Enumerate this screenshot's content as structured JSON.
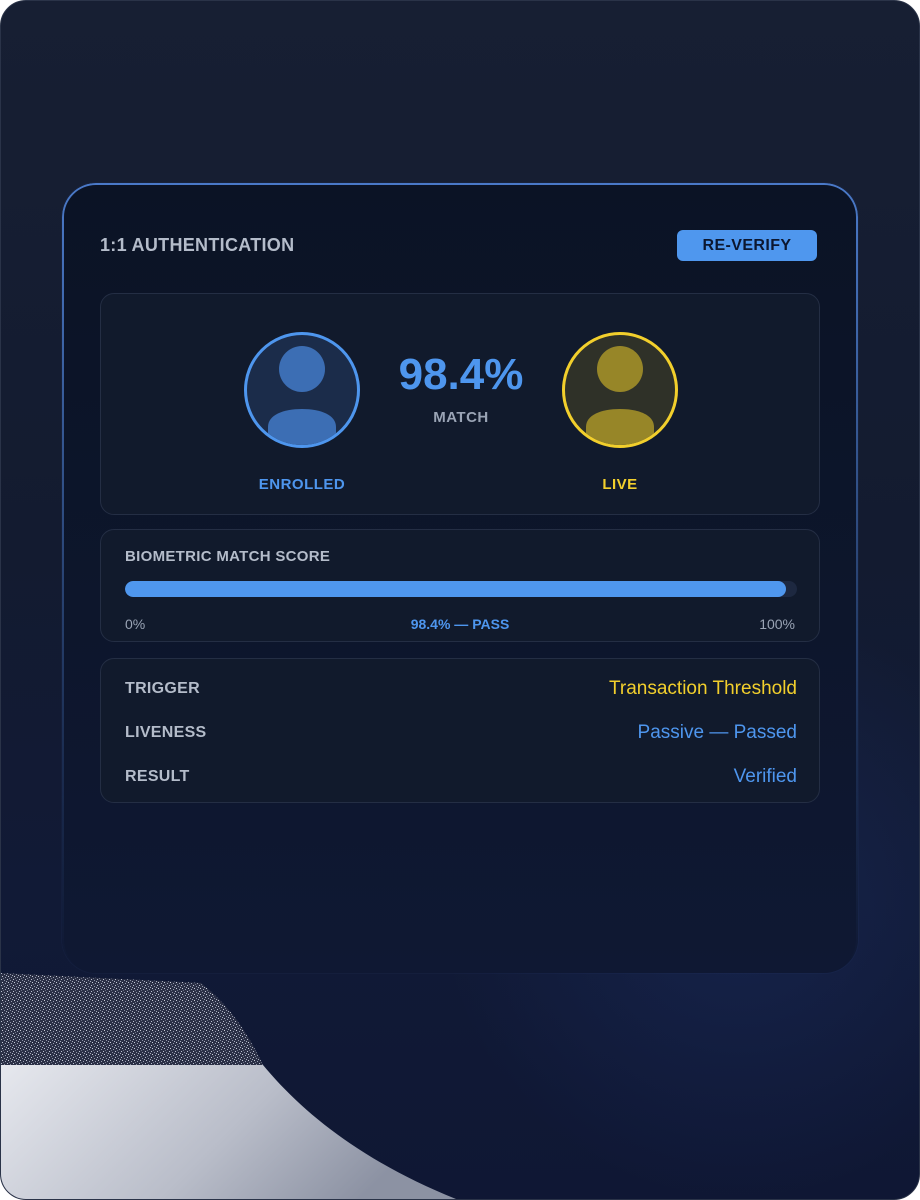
{
  "card": {
    "title": "1:1 AUTHENTICATION",
    "reverify_label": "RE-VERIFY"
  },
  "comparison": {
    "match_value": "98.4%",
    "match_label": "MATCH",
    "enrolled": {
      "label": "ENROLLED",
      "icon": "person-icon",
      "color": "#4e96ee"
    },
    "live": {
      "label": "LIVE",
      "icon": "person-icon",
      "color": "#f2cf2c"
    }
  },
  "score": {
    "title": "BIOMETRIC MATCH SCORE",
    "value_percent": 98.4,
    "min_label": "0%",
    "max_label": "100%",
    "result_label": "98.4% — PASS"
  },
  "details": [
    {
      "key": "TRIGGER",
      "value": "Transaction Threshold",
      "color": "#f2cf2c"
    },
    {
      "key": "LIVENESS",
      "value": "Passive — Passed",
      "color": "#4e96ee"
    },
    {
      "key": "RESULT",
      "value": "Verified",
      "color": "#4e96ee"
    }
  ],
  "colors": {
    "accent": "#4f97ee",
    "warning": "#f2cf2c",
    "background": "#131b30"
  }
}
